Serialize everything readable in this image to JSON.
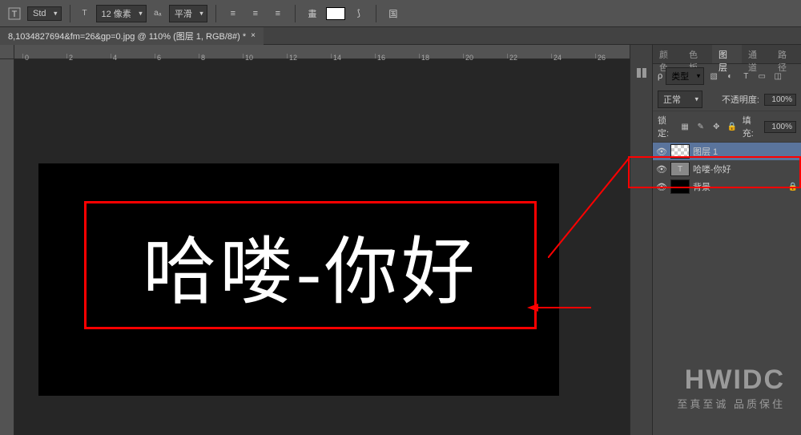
{
  "toolbar": {
    "font_style": "Std",
    "font_size_label": "12 像素",
    "aa_label": "平滑",
    "icons": {
      "type_tool": "T",
      "toggle": "畫",
      "align_l": "≡",
      "align_c": "≡",
      "align_r": "≡",
      "align_j": "≡",
      "swap": "↕",
      "more": "国"
    }
  },
  "doc_tab": {
    "title": "8,1034827694&fm=26&gp=0.jpg @ 110% (图层 1, RGB/8#) *",
    "close": "×"
  },
  "ruler": {
    "ticks": [
      "0",
      "2",
      "4",
      "6",
      "8",
      "10",
      "12",
      "14",
      "16",
      "18",
      "20",
      "22",
      "24",
      "26"
    ]
  },
  "canvas": {
    "text": "哈喽-你好"
  },
  "panel": {
    "tabs": [
      "颜色",
      "色板",
      "图层",
      "通道",
      "路径"
    ],
    "active_tab": 2,
    "filter_label": "类型",
    "blend_mode": "正常",
    "opacity_label": "不透明度:",
    "opacity_value": "100%",
    "lock_label": "锁定:",
    "fill_label": "填充:",
    "fill_value": "100%",
    "layers": [
      {
        "name": "图层 1",
        "type": "raster",
        "visible": true,
        "selected": true,
        "locked": false
      },
      {
        "name": "哈喽-你好",
        "type": "text",
        "visible": true,
        "selected": false,
        "locked": false
      },
      {
        "name": "背景",
        "type": "bg",
        "visible": true,
        "selected": false,
        "locked": true
      }
    ],
    "type_icon": "T"
  },
  "watermark": {
    "big": "HWIDC",
    "small": "至真至诚 品质保住"
  }
}
